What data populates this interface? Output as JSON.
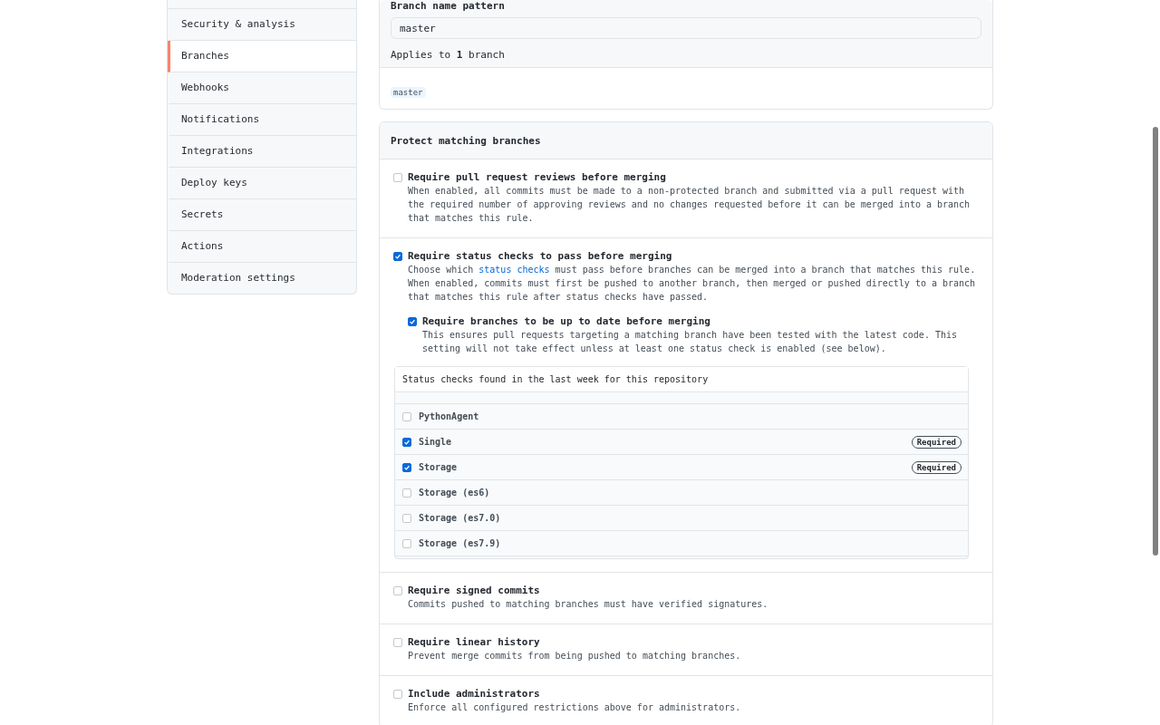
{
  "sidebar": {
    "items": [
      {
        "label": "Security & analysis",
        "selected": false
      },
      {
        "label": "Branches",
        "selected": true
      },
      {
        "label": "Webhooks",
        "selected": false
      },
      {
        "label": "Notifications",
        "selected": false
      },
      {
        "label": "Integrations",
        "selected": false
      },
      {
        "label": "Deploy keys",
        "selected": false
      },
      {
        "label": "Secrets",
        "selected": false
      },
      {
        "label": "Actions",
        "selected": false
      },
      {
        "label": "Moderation settings",
        "selected": false
      }
    ]
  },
  "pattern": {
    "label": "Branch name pattern",
    "value": "master",
    "applies": "Applies to **1** branch",
    "matches": [
      "master"
    ]
  },
  "protect": {
    "title": "Protect matching branches",
    "rules": [
      {
        "title": "Require pull request reviews before merging",
        "checked": false,
        "description": [
          {
            "kind": "text",
            "text": "When enabled, all commits must be made to a non-protected branch and submitted via a pull request with the required number of approving reviews and no changes requested before it can be merged into a branch that matches this rule."
          }
        ]
      },
      {
        "title": "Require status checks to pass before merging",
        "checked": true,
        "description": [
          {
            "kind": "text",
            "text": "Choose which "
          },
          {
            "kind": "link",
            "text": "status checks"
          },
          {
            "kind": "text",
            "text": " must pass before branches can be merged into a branch that matches this rule. When enabled, commits must first be pushed to another branch, then merged or pushed directly to a branch that matches this rule after status checks have passed."
          }
        ],
        "children": [
          {
            "title": "Require branches to be up to date before merging",
            "checked": true,
            "description": [
              {
                "kind": "text",
                "text": "This ensures pull requests targeting a matching branch have been tested with the latest code. This setting will not take effect unless at least one status check is enabled (see below)."
              }
            ]
          }
        ],
        "status_checks": {
          "heading": "Status checks found in the last week for this repository",
          "items": [
            {
              "name": "PythonAgent",
              "checked": false
            },
            {
              "name": "Single",
              "checked": true,
              "badge": "Required"
            },
            {
              "name": "Storage",
              "checked": true,
              "badge": "Required"
            },
            {
              "name": "Storage (es6)",
              "checked": false
            },
            {
              "name": "Storage (es7.0)",
              "checked": false
            },
            {
              "name": "Storage (es7.9)",
              "checked": false
            }
          ]
        }
      },
      {
        "title": "Require signed commits",
        "checked": false,
        "description": [
          {
            "kind": "text",
            "text": "Commits pushed to matching branches must have verified signatures."
          }
        ]
      },
      {
        "title": "Require linear history",
        "checked": false,
        "description": [
          {
            "kind": "text",
            "text": "Prevent merge commits from being pushed to matching branches."
          }
        ]
      },
      {
        "title": "Include administrators",
        "checked": false,
        "description": [
          {
            "kind": "text",
            "text": "Enforce all configured restrictions above for administrators."
          }
        ]
      }
    ]
  }
}
